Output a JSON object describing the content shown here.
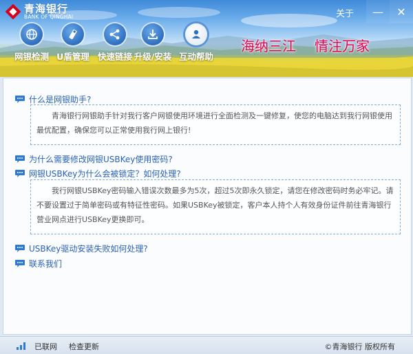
{
  "app": {
    "brand_cn": "青海银行",
    "brand_en": "BANK OF QINGHAI",
    "about_label": "关于",
    "minimize_symbol": "—",
    "close_symbol": "✕"
  },
  "nav": {
    "items": [
      {
        "label": "网银检测",
        "icon": "globe-icon"
      },
      {
        "label": "U盾管理",
        "icon": "usb-key-icon"
      },
      {
        "label": "快速链接",
        "icon": "share-icon"
      },
      {
        "label": "升级/安装",
        "icon": "download-icon"
      },
      {
        "label": "互动帮助",
        "icon": "user-icon",
        "active": true
      }
    ],
    "slogans": [
      "海纳三江",
      "情注万家"
    ]
  },
  "faq": {
    "items": [
      {
        "question": "什么是网银助手?",
        "answer": "青海银行网银助手针对我行客户网银使用环境进行全面检测及一键修复，使您的电脑达到我行网银使用最优配置，确保您可以正常使用我行网上银行!",
        "expanded": true
      },
      {
        "question": "为什么需要修改网银USBKey使用密码?",
        "expanded": false
      },
      {
        "question": "网银USBKey为什么会被锁定？如何处理?",
        "answer": "我行网银USBKey密码输入错误次数最多为5次，超过5次即永久锁定，请您在修改密码时务必牢记。请不要设置过于简单密码或有特征性密码。如果USBKey被锁定，客户本人持个人有效身份证件前往青海银行营业网点进行USBKey更换即可。",
        "expanded": true
      },
      {
        "question": "USBKey驱动安装失败如何处理?",
        "expanded": false
      },
      {
        "question": "联系我们",
        "expanded": false
      }
    ]
  },
  "status": {
    "connection": "已联网",
    "check_update": "检查更新",
    "copyright": "©青海银行 版权所有"
  },
  "colors": {
    "accent": "#2a62b8",
    "slogan": "#e8004f",
    "dashed_border": "#7dadd8"
  }
}
